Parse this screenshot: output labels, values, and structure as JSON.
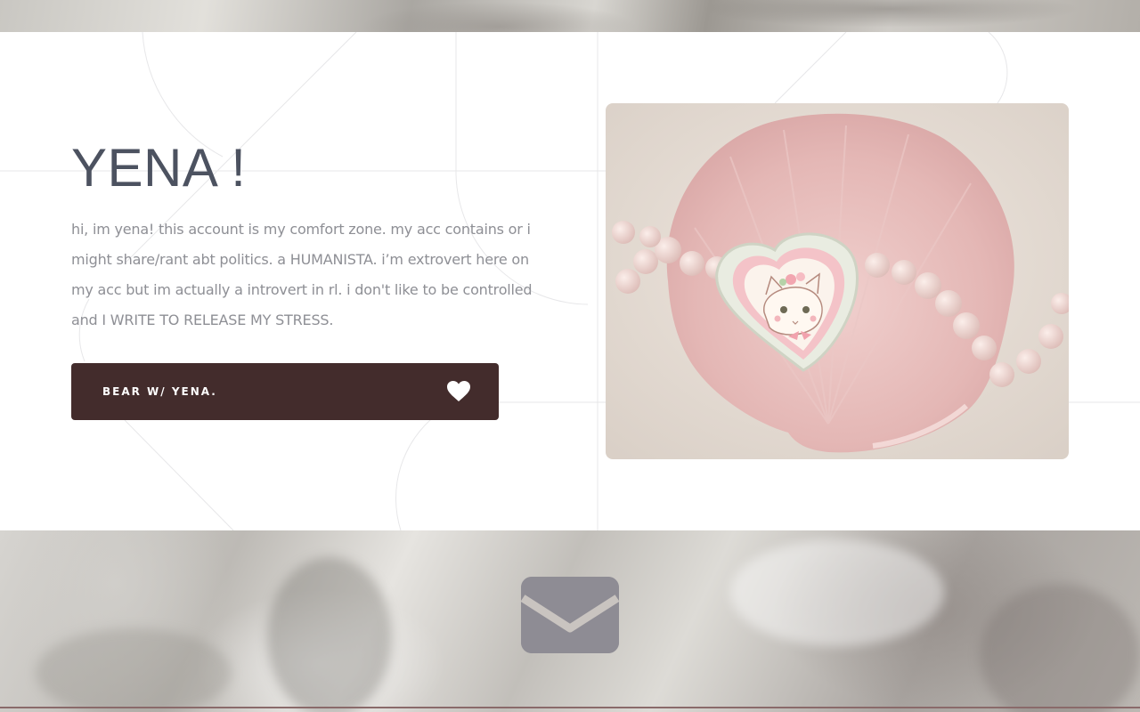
{
  "profile": {
    "name": "YENA !",
    "bio": "hi, im yena! this account is my comfort zone. my acc contains or i might share/rant abt politics. a HUMANISTA. i’m extrovert here on my acc but im actually a introvert in rl. i don't like to be controlled and I WRITE TO RELEASE MY STRESS."
  },
  "cta": {
    "label": "BEAR W/ YENA.",
    "icon": "heart-icon"
  },
  "contact": {
    "icon": "envelope-icon"
  },
  "colors": {
    "accent": "#432c2c",
    "title": "#4c5260",
    "body_text": "#8e8f95",
    "mail_icon": "#8e8c94",
    "line": "#8a6a6a"
  }
}
